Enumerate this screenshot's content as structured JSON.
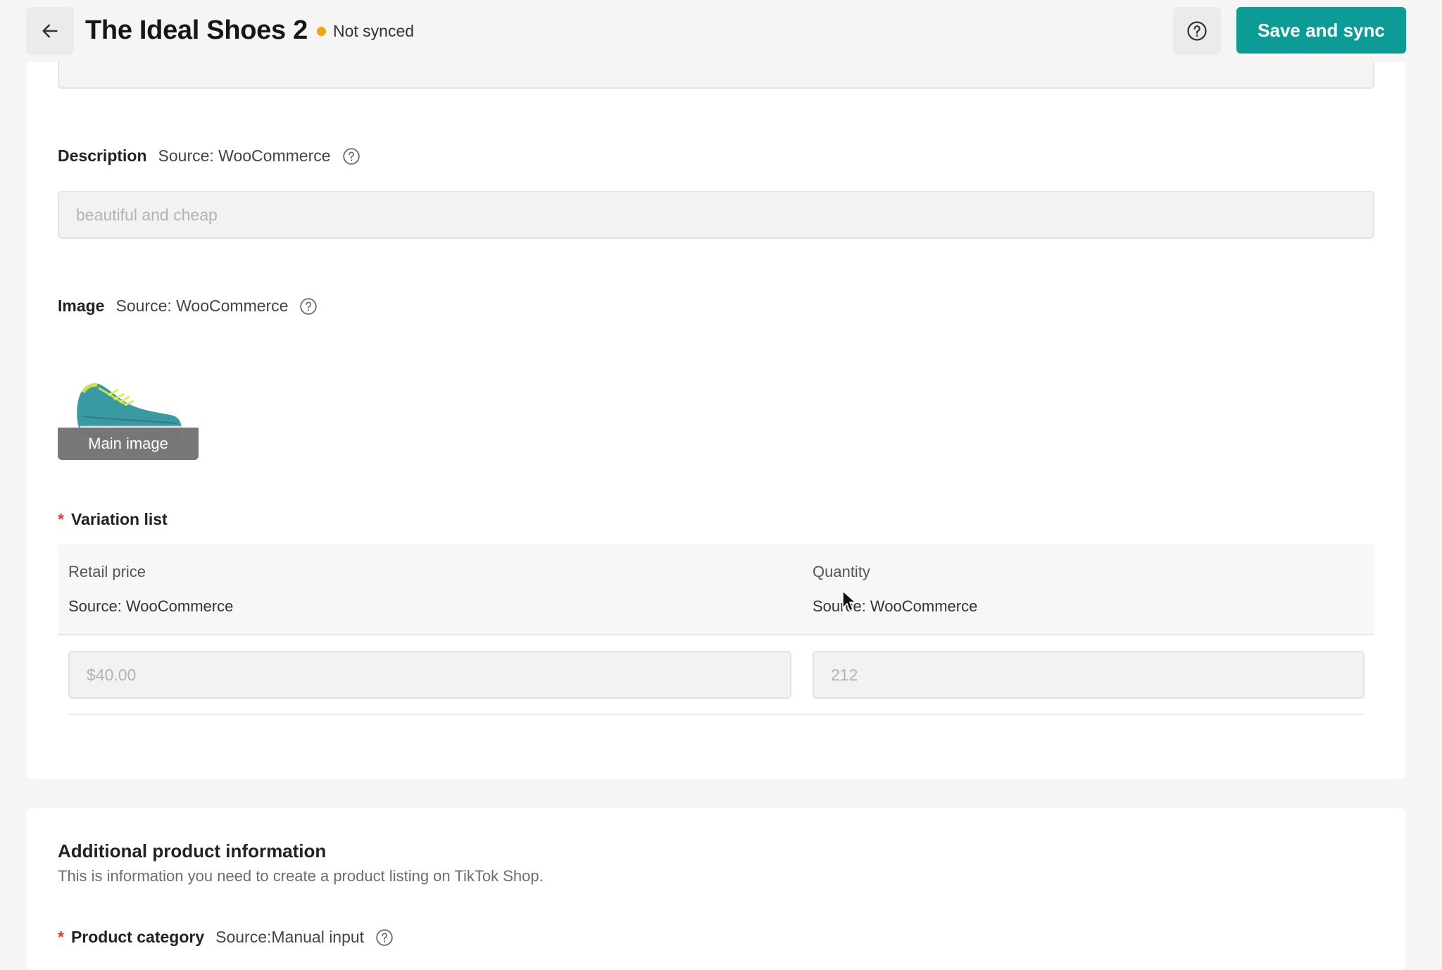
{
  "header": {
    "title": "The Ideal Shoes 2",
    "status": "Not synced",
    "save_label": "Save and sync"
  },
  "description": {
    "label": "Description",
    "source": "Source: WooCommerce",
    "value": "beautiful and cheap"
  },
  "image": {
    "label": "Image",
    "source": "Source: WooCommerce",
    "main_caption": "Main image"
  },
  "variation": {
    "label": "Variation list",
    "columns": [
      {
        "title": "Retail price",
        "source": "Source: WooCommerce"
      },
      {
        "title": "Quantity",
        "source": "Source: WooCommerce"
      }
    ],
    "rows": [
      {
        "price": "$40.00",
        "quantity": "212"
      }
    ]
  },
  "additional": {
    "title": "Additional product information",
    "subtitle": "This is information you need to create a product listing on TikTok Shop.",
    "category_label": "Product category",
    "category_source": "Source:Manual input"
  },
  "colors": {
    "accent": "#0d9c95",
    "status_dot": "#f0a30a",
    "required": "#e53935"
  },
  "icons": [
    "arrow-left-icon",
    "question-circle-icon",
    "shoe-image"
  ]
}
